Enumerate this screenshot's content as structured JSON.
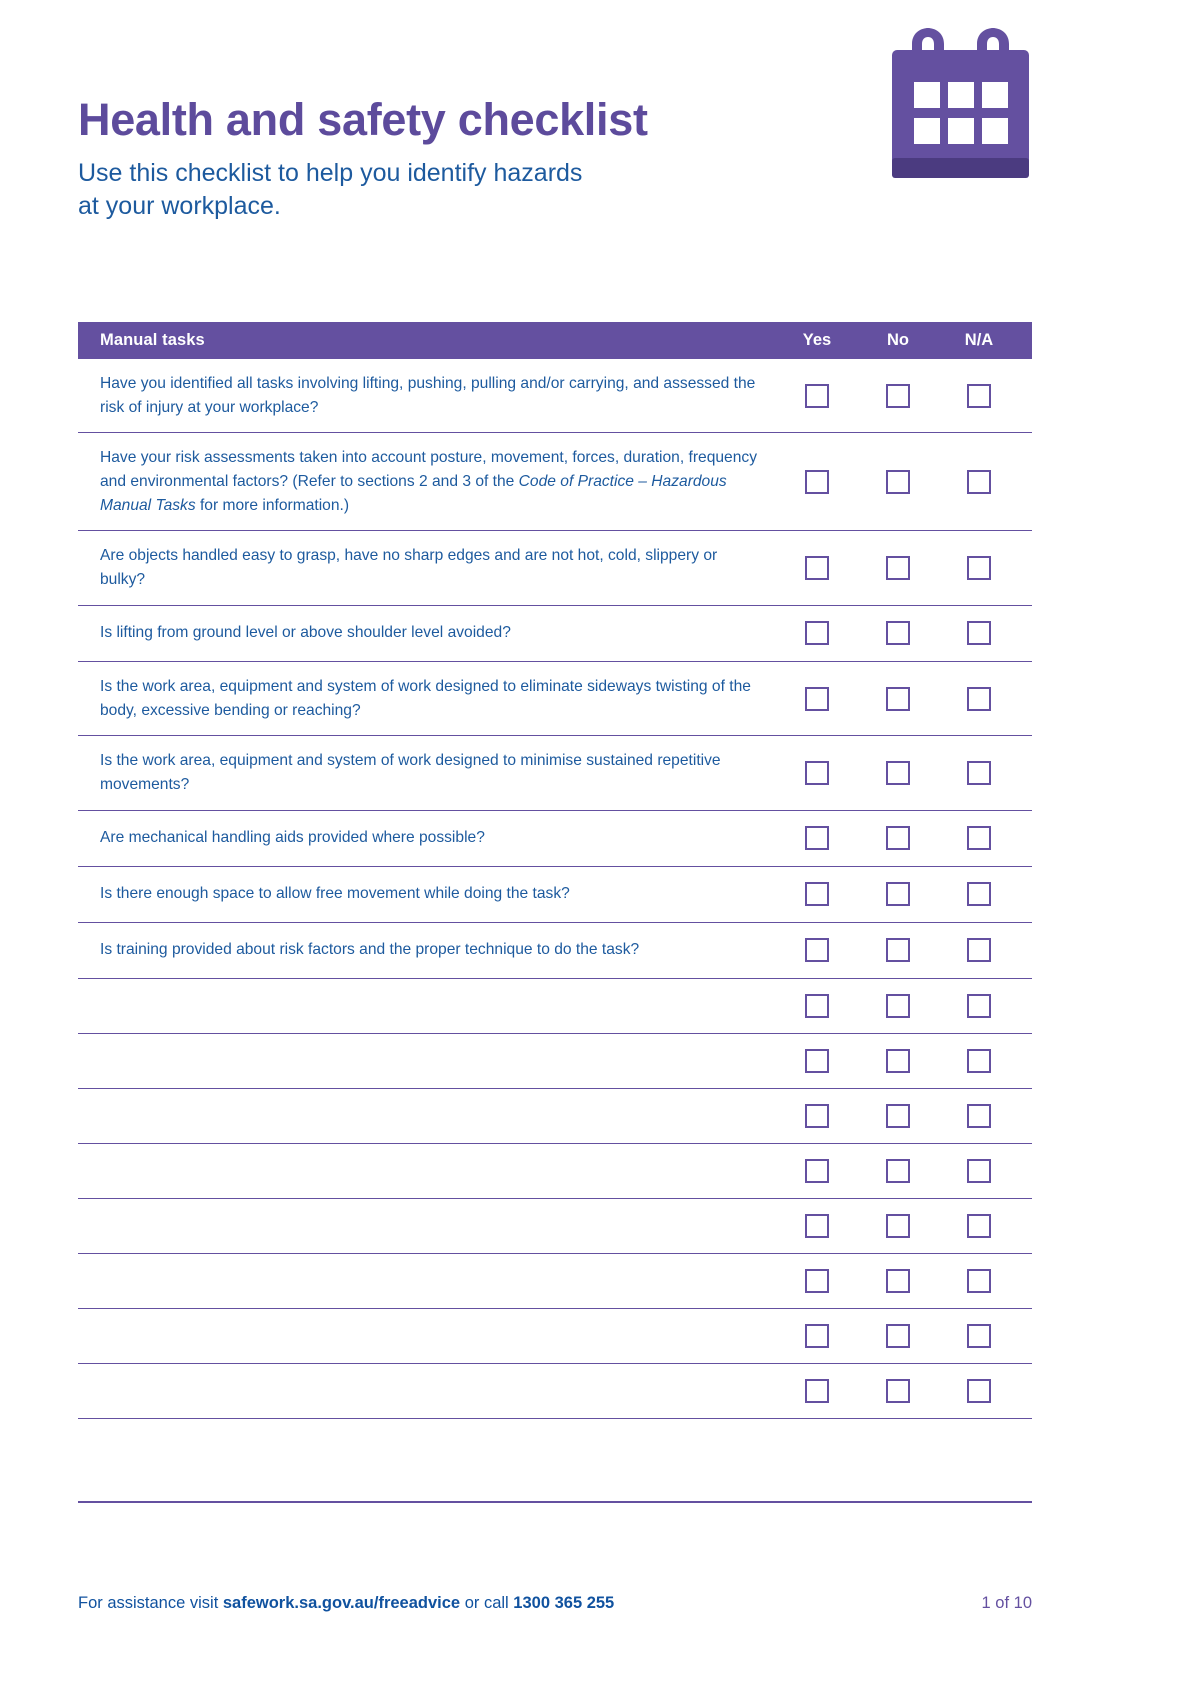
{
  "document": {
    "title": "Health and safety checklist",
    "subtitle_line1": "Use this checklist to help you identify hazards",
    "subtitle_line2": "at your workplace."
  },
  "logo": {
    "name": "clipboard-calendar-icon"
  },
  "colors": {
    "purple": "#6450a0",
    "title_purple": "#5d4b9c",
    "blue_text": "#1d5a9e",
    "footer_blue": "#10529f"
  },
  "table": {
    "header": {
      "section_label": "Manual tasks",
      "col_yes": "Yes",
      "col_no": "No",
      "col_na": "N/A"
    },
    "rows": [
      {
        "parts": [
          {
            "text": "Have you identified all tasks involving lifting, pushing, pulling and/or carrying, and assessed the risk of injury at your workplace?",
            "italic": false
          }
        ]
      },
      {
        "parts": [
          {
            "text": "Have your risk assessments taken into account posture, movement, forces, duration, frequency and environmental factors? (Refer to sections 2 and 3 of the ",
            "italic": false
          },
          {
            "text": "Code of Practice – Hazardous Manual Tasks",
            "italic": true
          },
          {
            "text": " for more information.)",
            "italic": false
          }
        ]
      },
      {
        "parts": [
          {
            "text": "Are objects handled easy to grasp, have no sharp edges and are not hot, cold, slippery or bulky?",
            "italic": false
          }
        ]
      },
      {
        "parts": [
          {
            "text": "Is lifting from ground level or above shoulder level avoided?",
            "italic": false
          }
        ]
      },
      {
        "parts": [
          {
            "text": "Is the work area, equipment and system of work designed to eliminate sideways twisting of the body, excessive bending or reaching?",
            "italic": false
          }
        ]
      },
      {
        "parts": [
          {
            "text": "Is the work area, equipment and system of work designed to minimise sustained repetitive movements?",
            "italic": false
          }
        ]
      },
      {
        "parts": [
          {
            "text": "Are mechanical handling aids provided where possible?",
            "italic": false
          }
        ]
      },
      {
        "parts": [
          {
            "text": "Is there enough space to allow free movement while doing the task?",
            "italic": false
          }
        ]
      },
      {
        "parts": [
          {
            "text": "Is training provided about risk factors and the proper technique to do the task?",
            "italic": false
          }
        ]
      },
      {
        "parts": []
      },
      {
        "parts": []
      },
      {
        "parts": []
      },
      {
        "parts": []
      },
      {
        "parts": []
      },
      {
        "parts": []
      },
      {
        "parts": []
      },
      {
        "parts": []
      }
    ]
  },
  "footer": {
    "text_prefix": "For assistance visit ",
    "website": "safework.sa.gov.au/freeadvice",
    "text_middle": " or call ",
    "phone": "1300 365 255",
    "page_number": "1 of 10"
  }
}
